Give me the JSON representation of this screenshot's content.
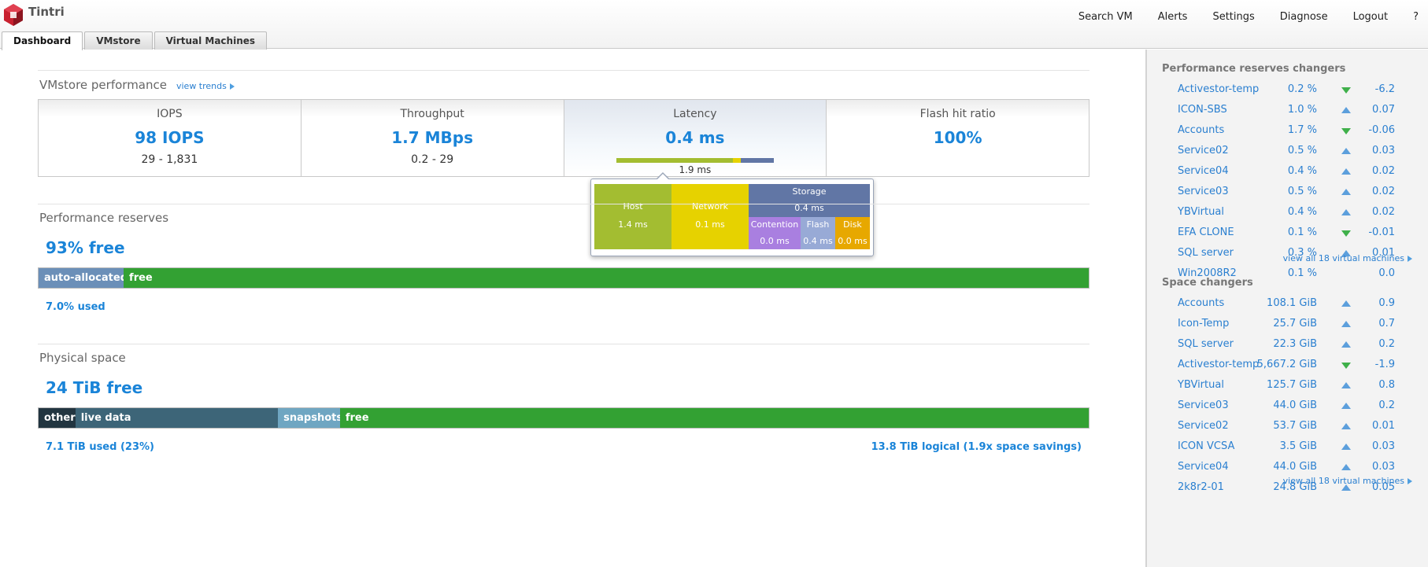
{
  "app": {
    "name": "Tintri"
  },
  "topnav": [
    "Search VM",
    "Alerts",
    "Settings",
    "Diagnose",
    "Logout",
    "?"
  ],
  "tabs": [
    {
      "label": "Dashboard",
      "active": true
    },
    {
      "label": "VMstore",
      "active": false
    },
    {
      "label": "Virtual Machines",
      "active": false
    }
  ],
  "performance": {
    "title": "VMstore performance",
    "trends_link": "view trends",
    "metrics": [
      {
        "label": "IOPS",
        "value": "98 IOPS",
        "range": "29 - 1,831"
      },
      {
        "label": "Throughput",
        "value": "1.7 MBps",
        "range": "0.2 - 29"
      },
      {
        "label": "Latency",
        "value": "0.4 ms",
        "range": "1.9 ms",
        "selected": true
      },
      {
        "label": "Flash hit ratio",
        "value": "100%",
        "range": ""
      }
    ],
    "latency_bar": [
      {
        "name": "host",
        "fraction": 0.74,
        "color": "#a3bd31"
      },
      {
        "name": "network",
        "fraction": 0.05,
        "color": "#e6d200"
      },
      {
        "name": "storage",
        "fraction": 0.21,
        "color": "#6176a5"
      }
    ],
    "tooltip": {
      "host": {
        "label": "Host",
        "value": "1.4 ms",
        "color": "#a3bd31"
      },
      "network": {
        "label": "Network",
        "value": "0.1 ms",
        "color": "#e6d200"
      },
      "storage": {
        "label": "Storage",
        "value": "0.4 ms",
        "color": "#6176a5"
      },
      "contention": {
        "label": "Contention",
        "value": "0.0 ms",
        "color": "#a97fe0"
      },
      "flash": {
        "label": "Flash",
        "value": "0.4 ms",
        "color": "#98aad6"
      },
      "disk": {
        "label": "Disk",
        "value": "0.0 ms",
        "color": "#e7a800"
      }
    }
  },
  "reserves": {
    "title": "Performance reserves",
    "free": "93% free",
    "used": "7.0% used",
    "segments": [
      {
        "label": "auto-allocated",
        "fraction": 0.081,
        "color": "#6b8fb8"
      },
      {
        "label": "free",
        "fraction": 0.919,
        "color": "#33a133"
      }
    ]
  },
  "physical": {
    "title": "Physical space",
    "free": "24 TiB free",
    "used": "7.1 TiB used (23%)",
    "logical": "13.8 TiB logical (1.9x space savings)",
    "segments": [
      {
        "label": "other",
        "fraction": 0.035,
        "color": "#223540"
      },
      {
        "label": "live data",
        "fraction": 0.193,
        "color": "#3d6578"
      },
      {
        "label": "snapshots",
        "fraction": 0.059,
        "color": "#6fa6c2"
      },
      {
        "label": "free",
        "fraction": 0.713,
        "color": "#33a133"
      }
    ]
  },
  "sidebar": {
    "perf_title": "Performance reserves changers",
    "perf_rows": [
      {
        "name": "Activestor-temp",
        "value": "0.2 %",
        "delta": "-6.2",
        "dir": "down"
      },
      {
        "name": "ICON-SBS",
        "value": "1.0 %",
        "delta": "0.07",
        "dir": "up"
      },
      {
        "name": "Accounts",
        "value": "1.7 %",
        "delta": "-0.06",
        "dir": "down"
      },
      {
        "name": "Service02",
        "value": "0.5 %",
        "delta": "0.03",
        "dir": "up"
      },
      {
        "name": "Service04",
        "value": "0.4 %",
        "delta": "0.02",
        "dir": "up"
      },
      {
        "name": "Service03",
        "value": "0.5 %",
        "delta": "0.02",
        "dir": "up"
      },
      {
        "name": "YBVirtual",
        "value": "0.4 %",
        "delta": "0.02",
        "dir": "up"
      },
      {
        "name": "EFA CLONE",
        "value": "0.1 %",
        "delta": "-0.01",
        "dir": "down"
      },
      {
        "name": "SQL server",
        "value": "0.3 %",
        "delta": "0.01",
        "dir": "up"
      },
      {
        "name": "Win2008R2",
        "value": "0.1 %",
        "delta": "0.0",
        "dir": "none"
      }
    ],
    "perf_link": "view all 18 virtual machines",
    "space_title": "Space changers",
    "space_rows": [
      {
        "name": "Accounts",
        "value": "108.1 GiB",
        "delta": "0.9",
        "dir": "up"
      },
      {
        "name": "Icon-Temp",
        "value": "25.7 GiB",
        "delta": "0.7",
        "dir": "up"
      },
      {
        "name": "SQL server",
        "value": "22.3 GiB",
        "delta": "0.2",
        "dir": "up"
      },
      {
        "name": "Activestor-temp",
        "value": "5,667.2 GiB",
        "delta": "-1.9",
        "dir": "down"
      },
      {
        "name": "YBVirtual",
        "value": "125.7 GiB",
        "delta": "0.8",
        "dir": "up"
      },
      {
        "name": "Service03",
        "value": "44.0 GiB",
        "delta": "0.2",
        "dir": "up"
      },
      {
        "name": "Service02",
        "value": "53.7 GiB",
        "delta": "0.01",
        "dir": "up"
      },
      {
        "name": "ICON VCSA",
        "value": "3.5 GiB",
        "delta": "0.03",
        "dir": "up"
      },
      {
        "name": "Service04",
        "value": "44.0 GiB",
        "delta": "0.03",
        "dir": "up"
      },
      {
        "name": "2k8r2-01",
        "value": "24.8 GiB",
        "delta": "0.05",
        "dir": "up"
      }
    ],
    "space_link": "view all 18 virtual machines"
  }
}
